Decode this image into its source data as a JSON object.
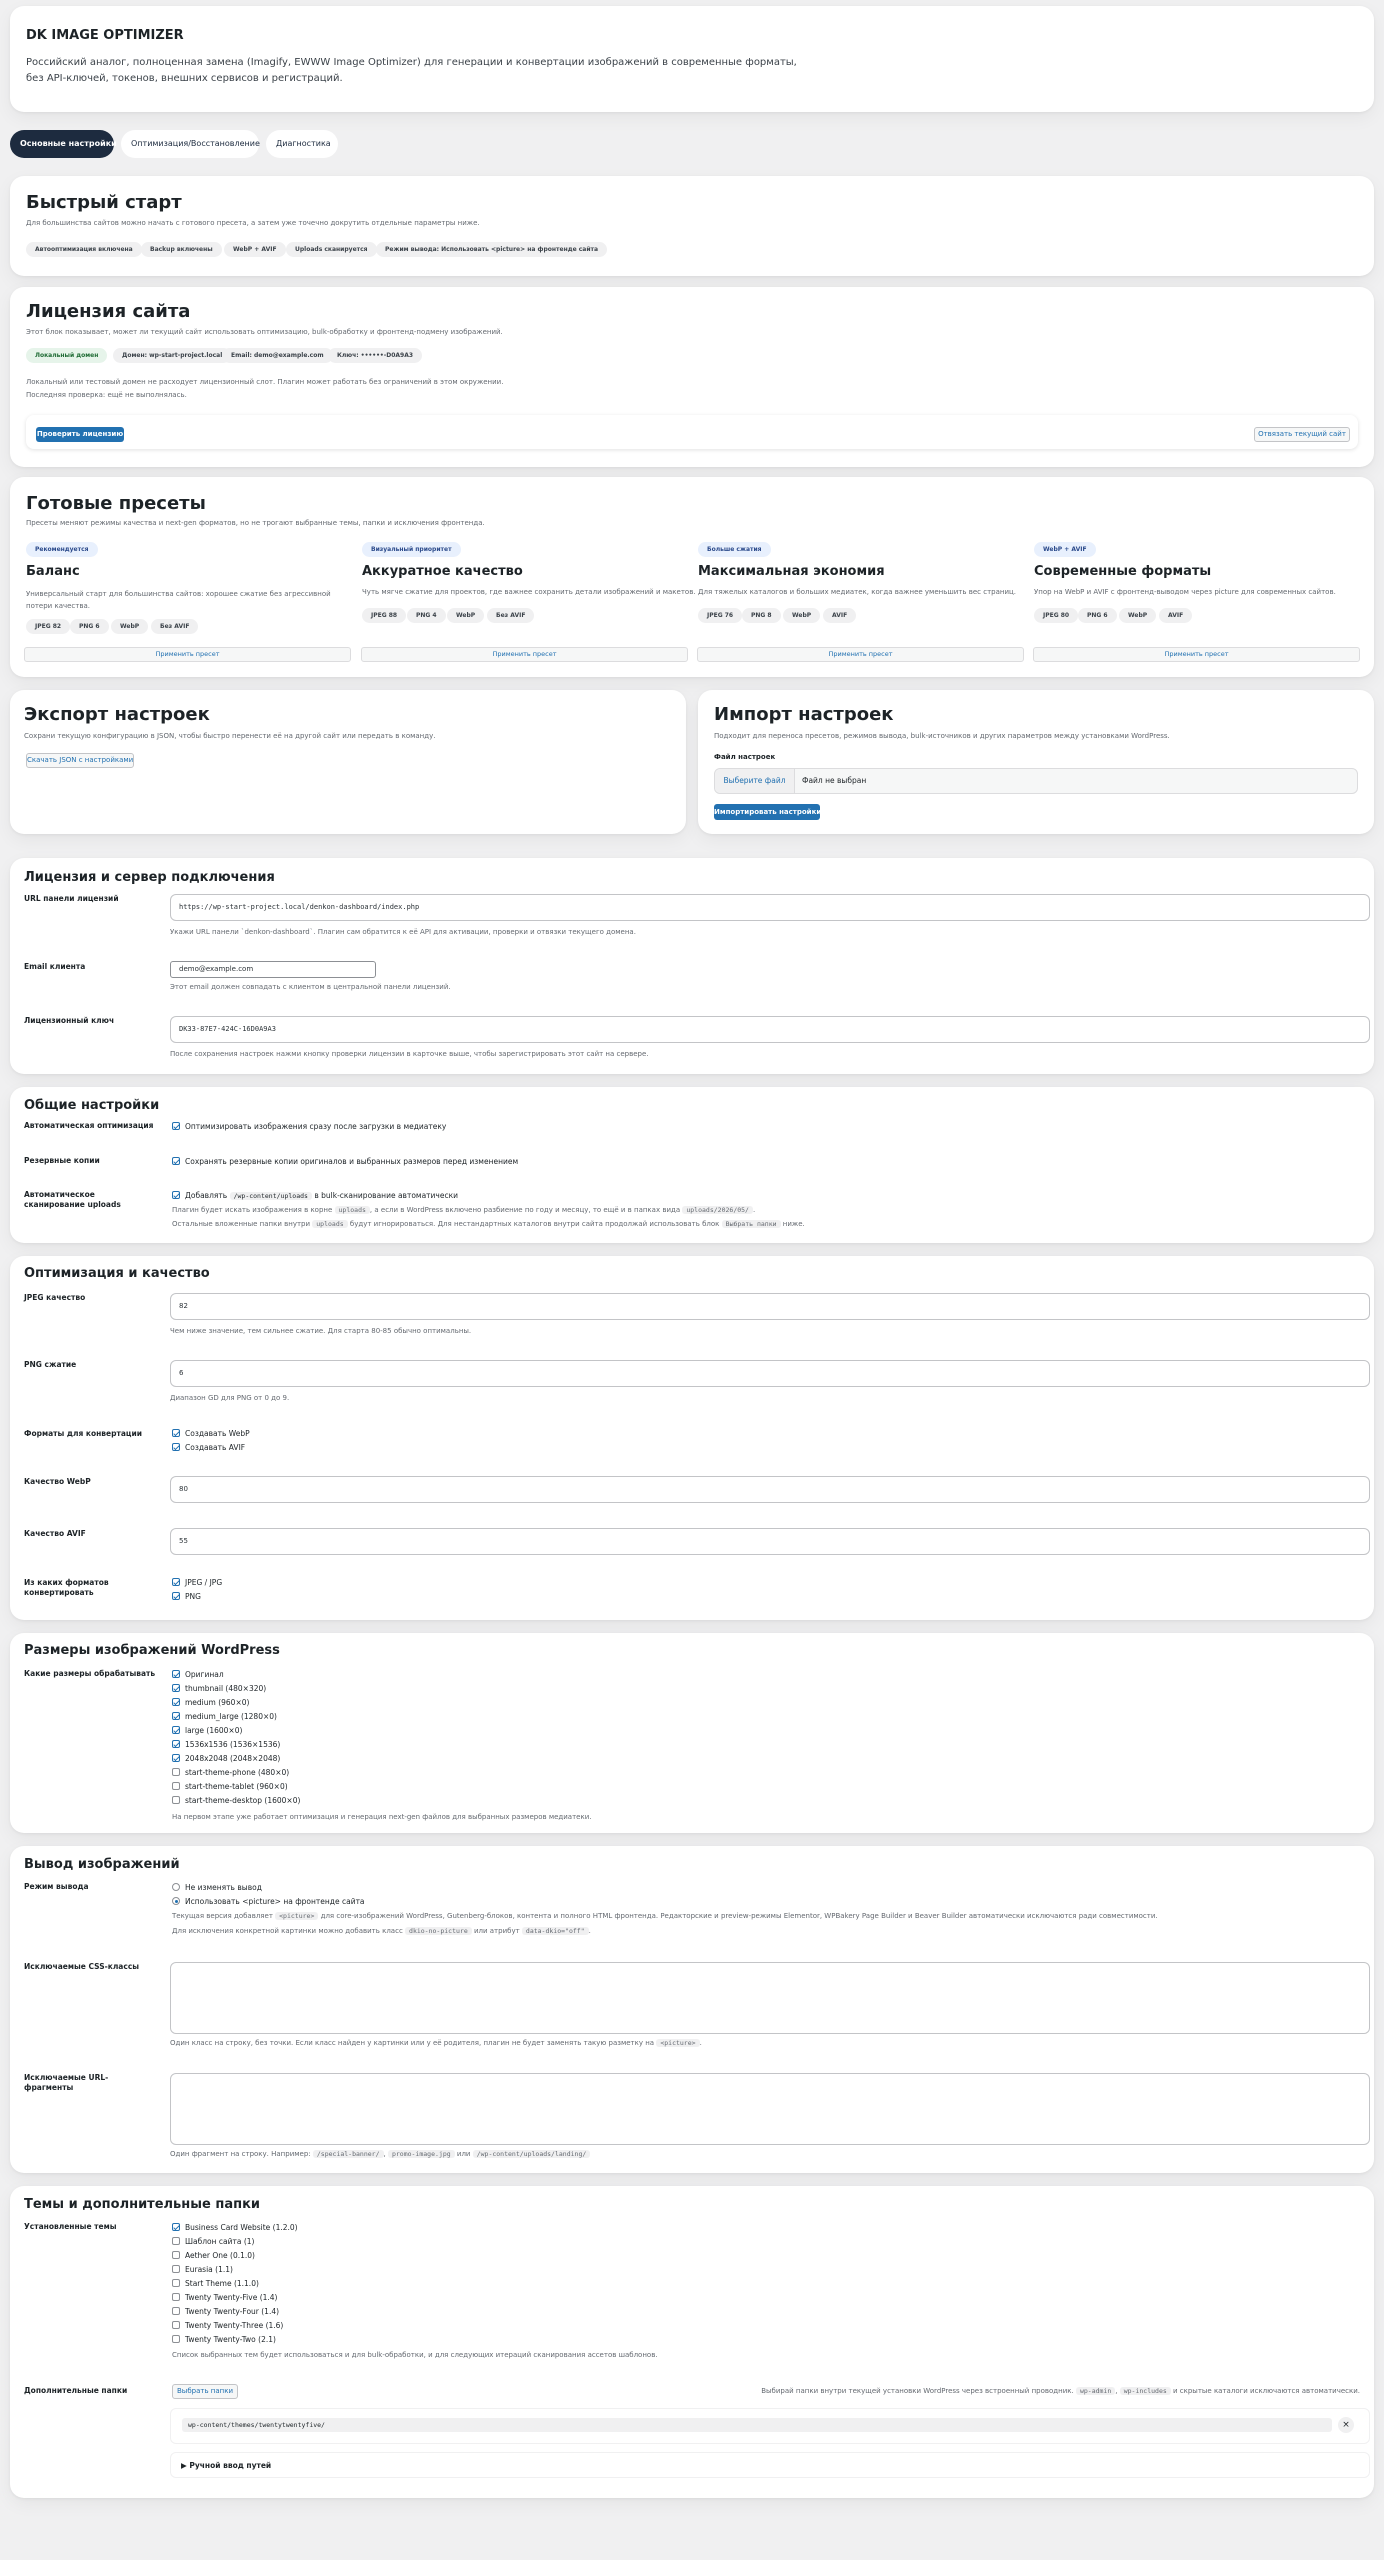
{
  "header": {
    "title": "DK IMAGE OPTIMIZER",
    "desc1": "Российский аналог, полноценная замена (Imagify, EWWW Image Optimizer) для генерации и конвертации изображений в современные форматы,",
    "desc2": "без API-ключей, токенов, внешних сервисов и регистраций."
  },
  "tabs": [
    "Основные настройки",
    "Оптимизация/Восстановление",
    "Диагностика"
  ],
  "quickstart": {
    "title": "Быстрый старт",
    "desc": "Для большинства сайтов можно начать с готового пресета, а затем уже точечно докрутить отдельные параметры ниже.",
    "chips": [
      "Автооптимизация включена",
      "Backup включены",
      "WebP + AVIF",
      "Uploads сканируется",
      "Режим вывода: Использовать <picture> на фронтенде сайта"
    ]
  },
  "license_card": {
    "title": "Лицензия сайта",
    "desc": "Этот блок показывает, может ли текущий сайт использовать оптимизацию, bulk-обработку и фронтенд-подмену изображений.",
    "chips": [
      "Локальный домен",
      "Домен: wp-start-project.local",
      "Email: demo@example.com",
      "Ключ: ••••••-D0A9A3"
    ],
    "note1": "Локальный или тестовый домен не расходует лицензионный слот. Плагин может работать без ограничений в этом окружении.",
    "note2": "Последняя проверка: ещё не выполнялась.",
    "check_btn": "Проверить лицензию",
    "release_btn": "Отвязать текущий сайт"
  },
  "presets": {
    "title": "Готовые пресеты",
    "desc": "Пресеты меняют режимы качества и next-gen форматов, но не трогают выбранные темы, папки и исключения фронтенда.",
    "apply": "Применить пресет",
    "items": [
      {
        "badge": "Рекомендуется",
        "name": "Баланс",
        "desc": "Универсальный старт для большинства сайтов: хорошее сжатие без агрессивной потери качества.",
        "tags": [
          "JPEG 82",
          "PNG 6",
          "WebP",
          "Без AVIF"
        ]
      },
      {
        "badge": "Визуальный приоритет",
        "name": "Аккуратное качество",
        "desc": "Чуть мягче сжатие для проектов, где важнее сохранить детали изображений и макетов.",
        "tags": [
          "JPEG 88",
          "PNG 4",
          "WebP",
          "Без AVIF"
        ]
      },
      {
        "badge": "Больше сжатия",
        "name": "Максимальная экономия",
        "desc": "Для тяжелых каталогов и больших медиатек, когда важнее уменьшить вес страниц.",
        "tags": [
          "JPEG 76",
          "PNG 8",
          "WebP",
          "AVIF"
        ]
      },
      {
        "badge": "WebP + AVIF",
        "name": "Современные форматы",
        "desc": "Упор на WebP и AVIF с фронтенд-выводом через picture для современных сайтов.",
        "tags": [
          "JPEG 80",
          "PNG 6",
          "WebP",
          "AVIF"
        ]
      }
    ]
  },
  "export": {
    "title": "Экспорт настроек",
    "desc": "Сохрани текущую конфигурацию в JSON, чтобы быстро перенести её на другой сайт или передать в команду.",
    "btn": "Скачать JSON с настройками"
  },
  "import": {
    "title": "Импорт настроек",
    "desc": "Подходит для переноса пресетов, режимов вывода, bulk-источников и других параметров между установками WordPress.",
    "file_label": "Файл настроек",
    "choose": "Выберите файл",
    "nofile": "Файл не выбран",
    "btn": "Импортировать настройки"
  },
  "server": {
    "title": "Лицензия и сервер подключения",
    "url_label": "URL панели лицензий",
    "url_value": "https://wp-start-project.local/denkon-dashboard/index.php",
    "url_help": "Укажи URL панели `denkon-dashboard`. Плагин сам обратится к её API для активации, проверки и отвязки текущего домена.",
    "email_label": "Email клиента",
    "email_value": "demo@example.com",
    "email_help": "Этот email должен совпадать с клиентом в центральной панели лицензий.",
    "key_label": "Лицензионный ключ",
    "key_value": "DK33-87E7-424C-16D0A9A3",
    "key_help": "После сохранения настроек нажми кнопку проверки лицензии в карточке выше, чтобы зарегистрировать этот сайт на сервере."
  },
  "general": {
    "title": "Общие настройки",
    "auto_label": "Автоматическая оптимизация",
    "auto_text": "Оптимизировать изображения сразу после загрузки в медиатеку",
    "backup_label": "Резервные копии",
    "backup_text": "Сохранять резервные копии оригиналов и выбранных размеров перед изменением",
    "scan_label1": "Автоматическое",
    "scan_label2": "сканирование uploads",
    "scan_text_a": "Добавлять",
    "scan_code": "/wp-content/uploads",
    "scan_text_b": "в bulk-сканирование автоматически",
    "scan_help1a": "Плагин будет искать изображения в корне",
    "scan_help1_code1": "uploads",
    "scan_help1b": ", а если в WordPress включено разбиение по году и месяцу, то ещё и в папках вида",
    "scan_help1_code2": "uploads/2026/05/",
    "scan_help1c": ".",
    "scan_help2a": "Остальные вложенные папки внутри",
    "scan_help2_code1": "uploads",
    "scan_help2b": "будут игнорироваться. Для нестандартных каталогов внутри сайта продолжай использовать блок",
    "scan_help2_code2": "Выбрать папки",
    "scan_help2c": "ниже."
  },
  "quality": {
    "title": "Оптимизация и качество",
    "jpeg_label": "JPEG качество",
    "jpeg_value": "82",
    "jpeg_help": "Чем ниже значение, тем сильнее сжатие. Для старта 80-85 обычно оптимальны.",
    "png_label": "PNG сжатие",
    "png_value": "6",
    "png_help": "Диапазон GD для PNG от 0 до 9.",
    "formats_label": "Форматы для конвертации",
    "fmt_webp": "Создавать WebP",
    "fmt_avif": "Создавать AVIF",
    "webp_label": "Качество WebP",
    "webp_value": "80",
    "avif_label": "Качество AVIF",
    "avif_value": "55",
    "from_label1": "Из каких форматов",
    "from_label2": "конвертировать",
    "from_jpeg": "JPEG / JPG",
    "from_png": "PNG"
  },
  "sizes": {
    "title": "Размеры изображений WordPress",
    "label": "Какие размеры обрабатывать",
    "items": [
      {
        "t": "Оригинал",
        "on": true
      },
      {
        "t": "thumbnail (480×320)",
        "on": true
      },
      {
        "t": "medium (960×0)",
        "on": true
      },
      {
        "t": "medium_large (1280×0)",
        "on": true
      },
      {
        "t": "large (1600×0)",
        "on": true
      },
      {
        "t": "1536x1536 (1536×1536)",
        "on": true
      },
      {
        "t": "2048x2048 (2048×2048)",
        "on": true
      },
      {
        "t": "start-theme-phone (480×0)",
        "on": false
      },
      {
        "t": "start-theme-tablet (960×0)",
        "on": false
      },
      {
        "t": "start-theme-desktop (1600×0)",
        "on": false
      }
    ],
    "help": "На первом этапе уже работает оптимизация и генерация next-gen файлов для выбранных размеров медиатеки."
  },
  "output": {
    "title": "Вывод изображений",
    "mode_label": "Режим вывода",
    "mode1": "Не изменять вывод",
    "mode2": "Использовать <picture> на фронтенде сайта",
    "help1a": "Текущая версия добавляет",
    "help1_code": "<picture>",
    "help1b": "для core-изображений WordPress, Gutenberg-блоков, контента и полного HTML фронтенда. Редакторские и preview-режимы Elementor, WPBakery Page Builder и Beaver Builder автоматически исключаются ради совместимости.",
    "help2a": "Для исключения конкретной картинки можно добавить класс",
    "help2_code1": "dkio-no-picture",
    "help2b": "или атрибут",
    "help2_code2": "data-dkio=\"off\"",
    "help2c": ".",
    "css_label": "Исключаемые CSS-классы",
    "css_help_a": "Один класс на строку, без точки. Если класс найден у картинки или у её родителя, плагин не будет заменять такую разметку на",
    "css_help_code": "<picture>",
    "css_help_b": ".",
    "url_label1": "Исключаемые URL-",
    "url_label2": "фрагменты",
    "url_help_a": "Один фрагмент на строку. Например:",
    "url_help_code1": "/special-banner/",
    "url_help_code2": "promo-image.jpg",
    "url_help_or": "или",
    "url_help_code3": "/wp-content/uploads/landing/"
  },
  "themes": {
    "title": "Темы и дополнительные папки",
    "label": "Установленные темы",
    "items": [
      {
        "t": "Business Card Website (1.2.0)",
        "on": true
      },
      {
        "t": "Шаблон сайта (1)",
        "on": false
      },
      {
        "t": "Aether One (0.1.0)",
        "on": false
      },
      {
        "t": "Eurasia (1.1)",
        "on": false
      },
      {
        "t": "Start Theme (1.1.0)",
        "on": false
      },
      {
        "t": "Twenty Twenty-Five (1.4)",
        "on": false
      },
      {
        "t": "Twenty Twenty-Four (1.4)",
        "on": false
      },
      {
        "t": "Twenty Twenty-Three (1.6)",
        "on": false
      },
      {
        "t": "Twenty Twenty-Two (2.1)",
        "on": false
      }
    ],
    "help": "Список выбранных тем будет использоваться и для bulk-обработки, и для следующих итераций сканирования ассетов шаблонов.",
    "folders_label": "Дополнительные папки",
    "folders_btn": "Выбрать папки",
    "folders_help_a": "Выбирай папки внутри текущей установки WordPress через встроенный проводник.",
    "folders_code1": "wp-admin",
    "folders_code2": "wp-includes",
    "folders_help_b": "и скрытые каталоги исключаются автоматически.",
    "folder_path": "wp-content/themes/twentytwentyfive/",
    "remove": "×",
    "manual": "▶ Ручной ввод путей"
  }
}
